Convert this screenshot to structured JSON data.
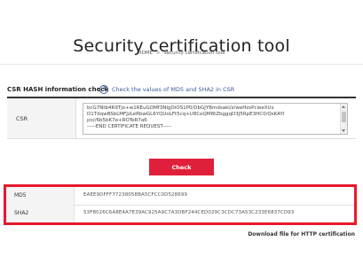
{
  "page": {
    "title": "Security certification tool",
    "breadcrumb": {
      "home": "HOME",
      "separator": ">",
      "current": "Security certification tool"
    }
  },
  "csr_section": {
    "heading": "CSR HASH information check",
    "info_link": "Check the values of MD5 and SHA2 in CSR",
    "info_icon": "info-circle-icon",
    "field_label": "CSR",
    "csr_value": "bcG7Ntb4R9Tjo+w1REuGOMf3NIgDiOS1P0/DbGJYBmdsakl/z/weHzsPcieeXUs\nD1TdqwBSbLMFJzLeRbwGL6YQUoLFt5cq+U8CeQM8tZbggqD3J5RpE3HC0/QsKAYI\npo//6b5bK7e+ROTeR7a6\n-----END CERTIFICATE REQUEST-----"
  },
  "actions": {
    "check_label": "Check"
  },
  "results": [
    {
      "label": "MD5",
      "value": "EAEE9DFFF77238058BA5CFCC0D528699"
    },
    {
      "label": "SHA2",
      "value": "53F8026C6A8E4A7E39AC925A9C7A3DBF244CED029C3CDC73A53C233E6837CD93"
    }
  ],
  "footer": {
    "download_link": "Download file for HTTP certification"
  },
  "colors": {
    "accent_red": "#e0203a",
    "highlight_border": "#e8182c",
    "link_blue": "#3a5a98"
  }
}
